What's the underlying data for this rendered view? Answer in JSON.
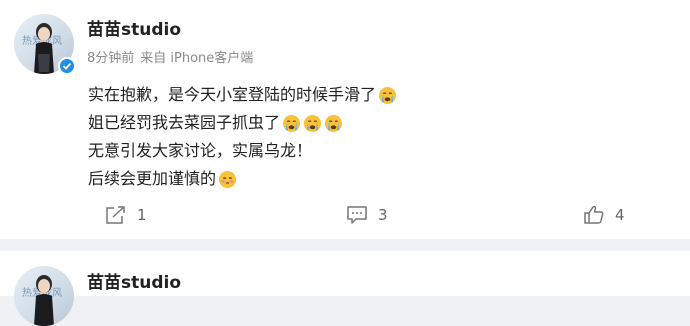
{
  "post1": {
    "author": "苗苗studio",
    "time": "8分钟前",
    "source": "来自 iPhone客户端",
    "avatar_caption": "热爱成风",
    "lines": [
      "实在抱歉，是今天小室登陆的时候手滑了",
      "姐已经罚我去菜园子抓虫了",
      "无意引发大家讨论，实属乌龙！",
      "后续会更加谨慎的"
    ],
    "emojis": {
      "line1": [
        "crying-face"
      ],
      "line2": [
        "crying-face",
        "crying-face",
        "crying-face"
      ],
      "line4": [
        "shy-face"
      ]
    },
    "share_count": "1",
    "comment_count": "3",
    "like_count": "4"
  },
  "post2": {
    "author": "苗苗studio",
    "avatar_caption": "热爱成风"
  },
  "colors": {
    "background": "#f0f1f4",
    "card": "#ffffff",
    "verified": "#1f8fe8",
    "emoji_face": "#f8c23b"
  }
}
